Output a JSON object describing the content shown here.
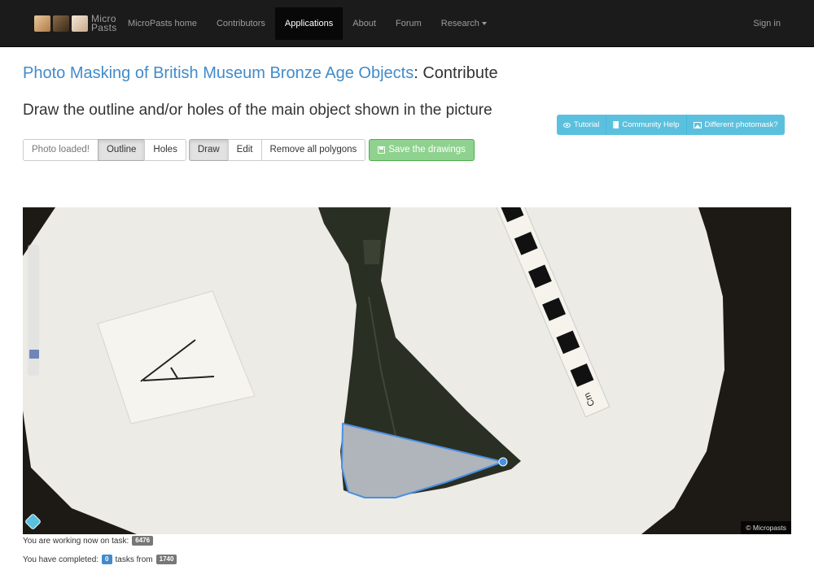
{
  "navbar": {
    "logo_text_top": "Micro",
    "logo_text_bottom": "Pasts",
    "items": [
      {
        "label": "MicroPasts home"
      },
      {
        "label": "Contributors"
      },
      {
        "label": "Applications",
        "active": true
      },
      {
        "label": "About"
      },
      {
        "label": "Forum"
      },
      {
        "label": "Research",
        "has_dropdown": true
      }
    ],
    "sign_in": "Sign in"
  },
  "header": {
    "project_link": "Photo Masking of British Museum Bronze Age Objects",
    "suffix": ": Contribute",
    "instructions": "Draw the outline and/or holes of the main object shown in the picture"
  },
  "help_buttons": [
    {
      "label": "Tutorial",
      "icon": "eye-icon"
    },
    {
      "label": "Community Help",
      "icon": "book-icon"
    },
    {
      "label": "Different photomask?",
      "icon": "picture-icon"
    }
  ],
  "toolbar": {
    "status": "Photo loaded!",
    "outline": "Outline",
    "holes": "Holes",
    "draw": "Draw",
    "edit": "Edit",
    "remove_all": "Remove all polygons",
    "save": "Save the drawings"
  },
  "viewer": {
    "copyright": "© Micropasts",
    "scale_bar_text": "Cm",
    "card_letter": "A"
  },
  "status": {
    "working_text": "You are working now on task:",
    "task_id": "6476",
    "completed_text": "You have completed:",
    "completed_count": "0",
    "tasks_from_text": "tasks from",
    "total_tasks": "1740"
  },
  "colors": {
    "navbar_bg": "#1b1b1b",
    "link_blue": "#428bca",
    "info_button": "#5bc0de",
    "success_button": "#8fd28f",
    "polygon_stroke": "#4a90e2"
  }
}
